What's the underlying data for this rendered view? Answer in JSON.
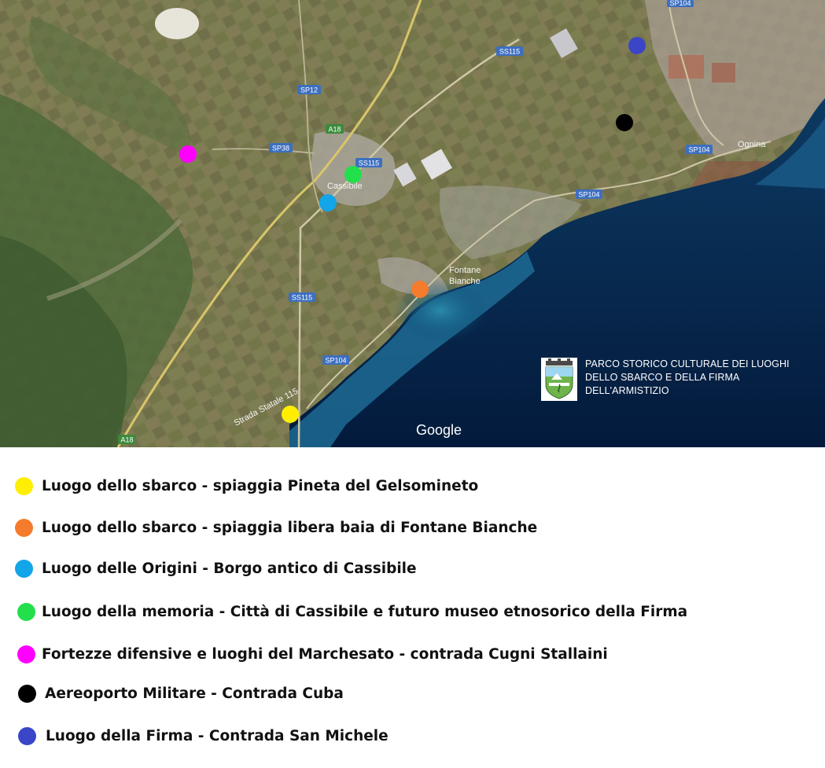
{
  "map": {
    "google_logo": "Google",
    "places": [
      "Cassibile",
      "Fontane",
      "Bianche",
      "Ognina"
    ],
    "roads": {
      "sp12": "SP12",
      "a18_top": "A18",
      "sp38": "SP38",
      "ss115_a": "SS115",
      "ss115_b": "SS115",
      "ss115_c": "SS115",
      "sp104_a": "SP104",
      "sp104_b": "SP104",
      "sp104_c": "SP104",
      "a18_bottom": "A18",
      "ss115_curved": "Strada Statale 115",
      "sp104_top": "SP104"
    },
    "markers": [
      {
        "color": "#ffee00",
        "icon": "yellow-marker"
      },
      {
        "color": "#f47c2c",
        "icon": "orange-marker"
      },
      {
        "color": "#12a5e8",
        "icon": "blue-marker"
      },
      {
        "color": "#22e04c",
        "icon": "green-marker"
      },
      {
        "color": "#ff00ff",
        "icon": "magenta-marker"
      },
      {
        "color": "#000000",
        "icon": "black-marker"
      },
      {
        "color": "#3b45c8",
        "icon": "indigo-marker"
      }
    ]
  },
  "park": {
    "title": "PARCO STORICO CULTURALE DEI LUOGHI DELLO SBARCO E DELLA FIRMA DELL'ARMISTIZIO",
    "logo_icon": "park-crest-logo"
  },
  "legend": {
    "items": [
      {
        "color": "#ffee00",
        "label": "Luogo dello sbarco - spiaggia Pineta del Gelsomineto"
      },
      {
        "color": "#f47c2c",
        "label": "Luogo dello sbarco - spiaggia libera baia di Fontane Bianche"
      },
      {
        "color": "#12a5e8",
        "label": "Luogo delle Origini - Borgo antico di Cassibile"
      },
      {
        "color": "#22e04c",
        "label": "Luogo della memoria - Città di Cassibile e futuro museo etnosorico della Firma"
      },
      {
        "color": "#ff00ff",
        "label": "Fortezze difensive e luoghi del Marchesato - contrada Cugni Stallaini"
      },
      {
        "color": "#000000",
        "label": "Aereoporto Militare - Contrada Cuba"
      },
      {
        "color": "#3b45c8",
        "label": "Luogo della Firma - Contrada San Michele"
      }
    ]
  }
}
